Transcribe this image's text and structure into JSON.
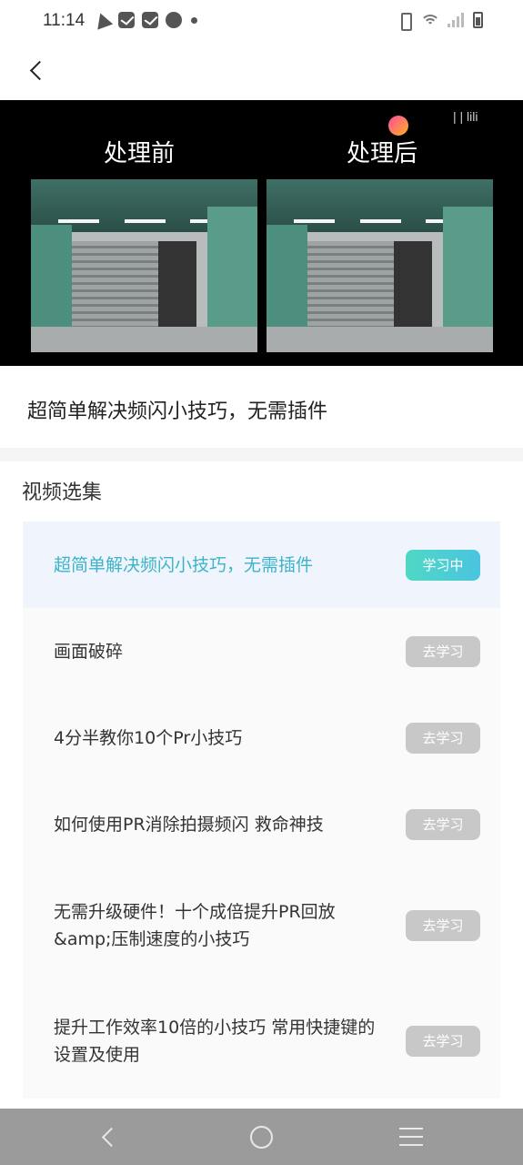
{
  "status_bar": {
    "time": "11:14",
    "left_icons": [
      "telegram-icon",
      "mail-icon",
      "mail-icon",
      "speed-icon",
      "dot-icon"
    ],
    "right_icons": [
      "vibrate-icon",
      "wifi-icon",
      "signal-icon",
      "battery-icon"
    ]
  },
  "header": {
    "back_icon": "chevron-left-icon"
  },
  "video": {
    "label_before": "处理前",
    "label_after": "处理后",
    "watermark": "| | lili"
  },
  "video_title": "超简单解决频闪小技巧，无需插件",
  "episodes": {
    "heading": "视频选集",
    "items": [
      {
        "title": "超简单解决频闪小技巧，无需插件",
        "button": "学习中",
        "active": true
      },
      {
        "title": "画面破碎",
        "button": "去学习",
        "active": false
      },
      {
        "title": "4分半教你10个Pr小技巧",
        "button": "去学习",
        "active": false
      },
      {
        "title": "如何使用PR消除拍摄频闪 救命神技",
        "button": "去学习",
        "active": false
      },
      {
        "title": "无需升级硬件！十个成倍提升PR回放&amp;压制速度的小技巧",
        "button": "去学习",
        "active": false
      },
      {
        "title": "提升工作效率10倍的小技巧 常用快捷键的设置及使用",
        "button": "去学习",
        "active": false
      }
    ]
  },
  "colors": {
    "active_text": "#3cb3c8",
    "active_bg": "#f0f5fd",
    "active_button": "#4fd8c4",
    "inactive_button": "#c8c8c8",
    "nav_bar": "#9b9b9b"
  },
  "nav_bar": {
    "icons": [
      "back-icon",
      "home-icon",
      "menu-icon"
    ]
  }
}
